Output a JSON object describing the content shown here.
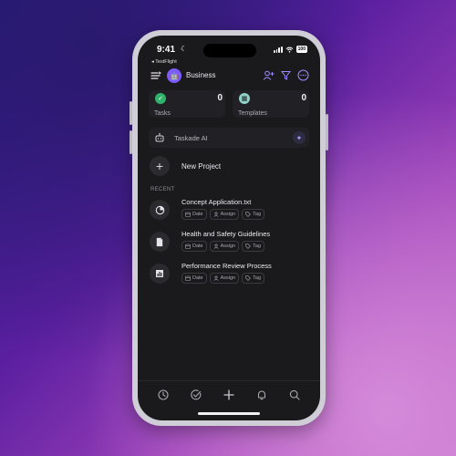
{
  "status_bar": {
    "time": "9:41",
    "back_app": "◂ TestFlight",
    "battery": "100"
  },
  "header": {
    "workspace_name": "Business",
    "workspace_emoji": "🤖"
  },
  "summary_cards": [
    {
      "label": "Tasks",
      "count": "0",
      "color": "#2fb36b"
    },
    {
      "label": "Templates",
      "count": "0",
      "color": "#8fd3c8"
    }
  ],
  "ai_bar": {
    "label": "Taskade AI"
  },
  "new_project": {
    "label": "New Project"
  },
  "recent": {
    "heading": "RECENT",
    "items": [
      {
        "title": "Concept Application.txt",
        "icon": "pie-icon",
        "chips": [
          "Date",
          "Assign",
          "Tag"
        ]
      },
      {
        "title": "Health and Safety Guidelines",
        "icon": "document-icon",
        "chips": [
          "Date",
          "Assign",
          "Tag"
        ]
      },
      {
        "title": "Performance Review Process",
        "icon": "bar-chart-icon",
        "chips": [
          "Date",
          "Assign",
          "Tag"
        ]
      }
    ]
  },
  "tab_bar": [
    "clock-icon",
    "check-circle-icon",
    "plus-icon",
    "bell-icon",
    "search-icon"
  ],
  "colors": {
    "accent": "#7c5cff",
    "screen_bg": "#1a1a1d",
    "card_bg": "#212125"
  }
}
